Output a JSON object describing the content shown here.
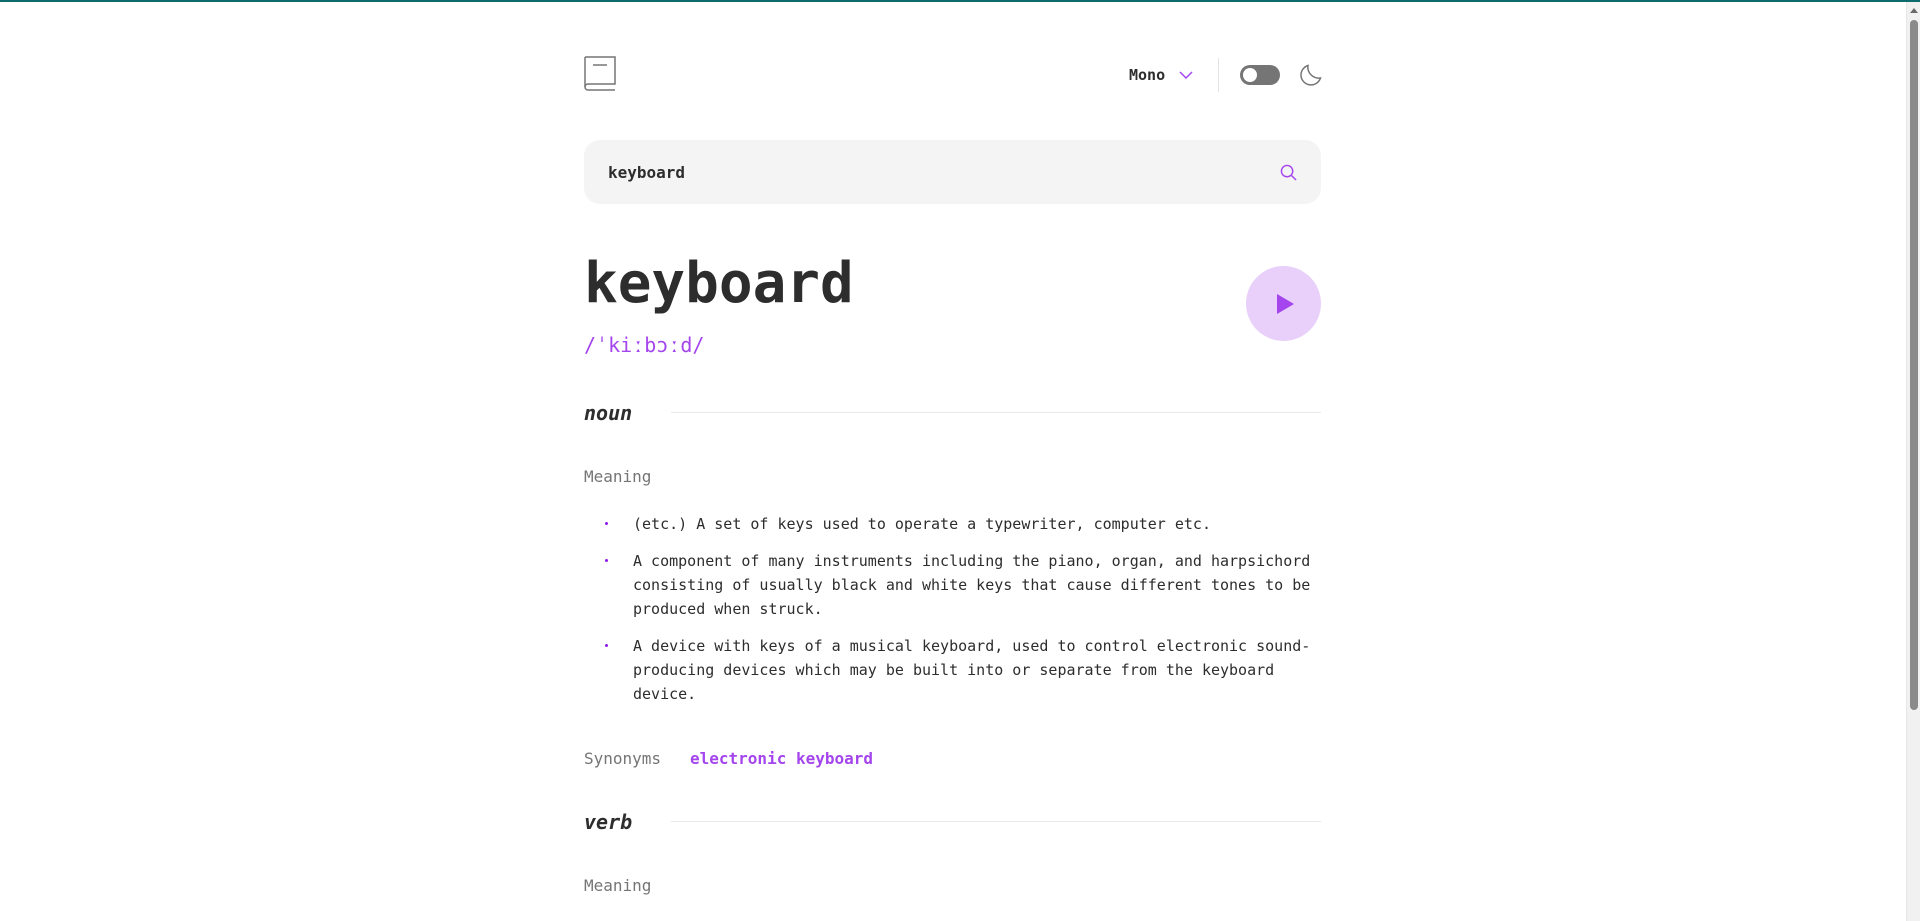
{
  "header": {
    "font_selected": "Mono",
    "theme_toggle": "off",
    "icons": [
      "book-icon",
      "chevron-down-icon",
      "moon-icon"
    ]
  },
  "search": {
    "value": "keyboard",
    "icon": "search-icon"
  },
  "entry": {
    "word": "keyboard",
    "phonetic": "/ˈkiːbɔːd/",
    "play_icon": "play-icon",
    "meanings": [
      {
        "part_of_speech": "noun",
        "label": "Meaning",
        "definitions": [
          "(etc.) A set of keys used to operate a typewriter, computer etc.",
          "A component of many instruments including the piano, organ, and harpsichord consisting of usually black and white keys that cause different tones to be produced when struck.",
          "A device with keys of a musical keyboard, used to control electronic sound-producing devices which may be built into or separate from the keyboard device."
        ],
        "synonyms_label": "Synonyms",
        "synonyms": [
          "electronic keyboard"
        ]
      },
      {
        "part_of_speech": "verb",
        "label": "Meaning"
      }
    ]
  },
  "colors": {
    "accent": "#A445ED",
    "accent_light": "#E9D0FA",
    "text": "#2D2D2D",
    "muted": "#757575",
    "search_bg": "#F4F4F4"
  }
}
